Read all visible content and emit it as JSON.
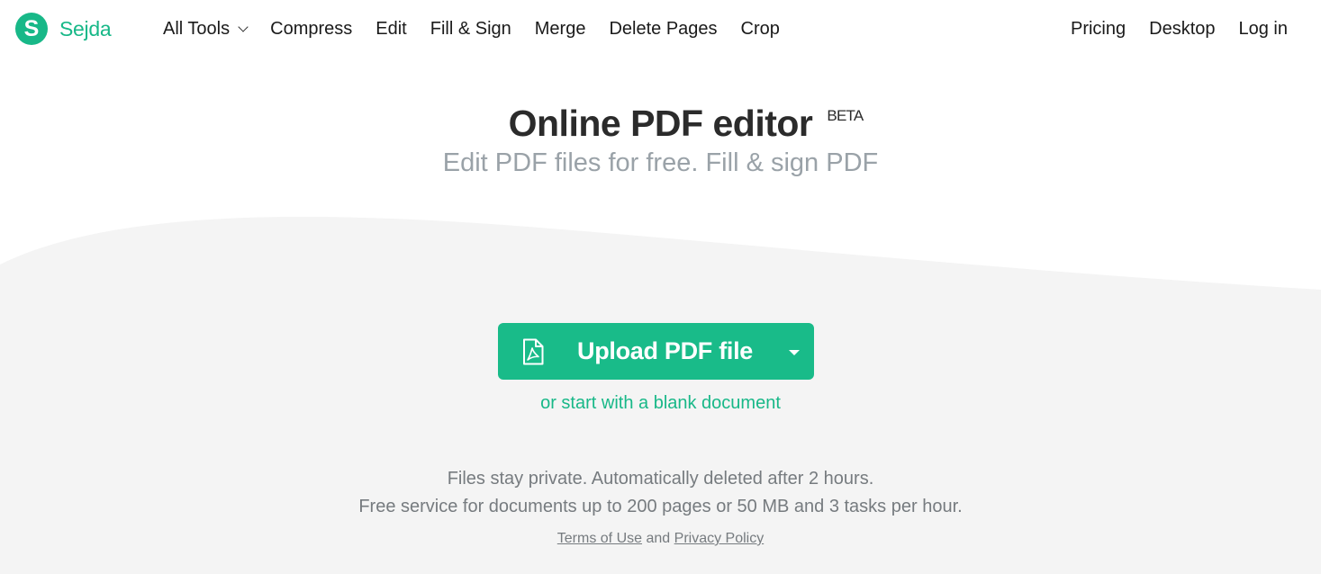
{
  "brand": {
    "logo_letter": "S",
    "name": "Sejda",
    "accent_color": "#18b888"
  },
  "nav": {
    "all_tools": "All Tools",
    "items": [
      "Compress",
      "Edit",
      "Fill & Sign",
      "Merge",
      "Delete Pages",
      "Crop"
    ],
    "right": [
      "Pricing",
      "Desktop",
      "Log in"
    ]
  },
  "hero": {
    "title": "Online PDF editor",
    "badge": "BETA",
    "subtitle": "Edit PDF files for free. Fill & sign PDF"
  },
  "upload": {
    "label": "Upload PDF file",
    "icon": "pdf-file-icon",
    "dropdown_icon": "caret-down-icon",
    "blank_link": "or start with a blank document"
  },
  "info": {
    "line1": "Files stay private. Automatically deleted after 2 hours.",
    "line2": "Free service for documents up to 200 pages or 50 MB and 3 tasks per hour."
  },
  "legal": {
    "terms": "Terms of Use",
    "and": "and",
    "privacy": "Privacy Policy"
  }
}
